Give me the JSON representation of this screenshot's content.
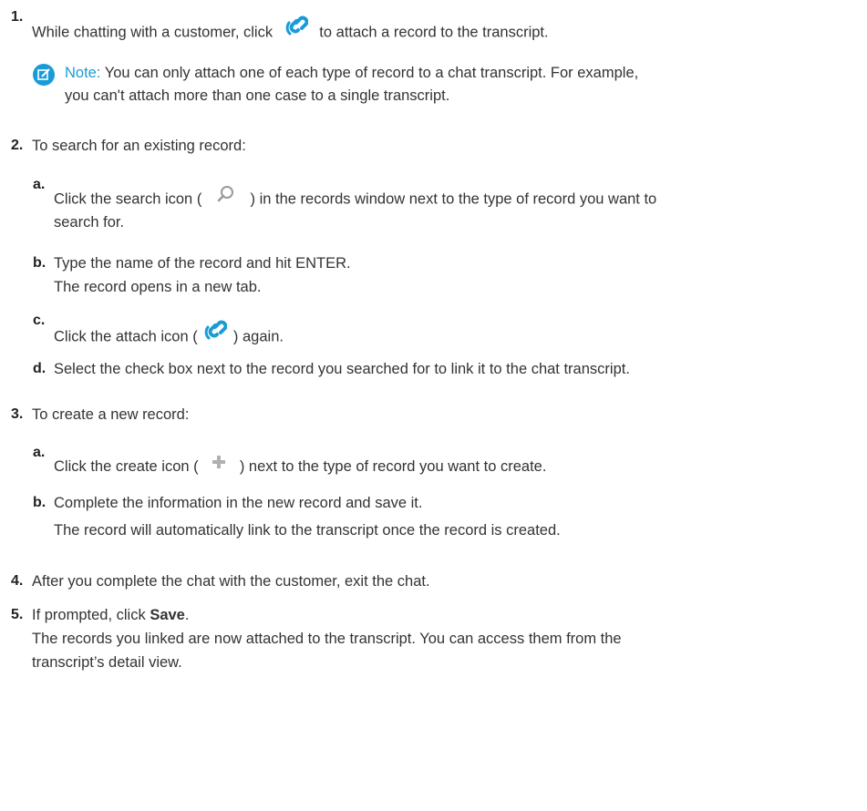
{
  "steps": {
    "s1": {
      "num": "1.",
      "pre": "While chatting with a customer, click",
      "post": "to attach a record to the transcript.",
      "note": {
        "label": "Note:",
        "line1": "You can only attach one of each type of record to a chat transcript. For example,",
        "line2": "you can't attach more than one case to a single transcript."
      }
    },
    "s2": {
      "num": "2.",
      "text": "To search for an existing record:",
      "a": {
        "num": "a.",
        "pre": "Click the search icon (",
        "post": ") in the records window next to the type of record you want to",
        "line2": "search for."
      },
      "b": {
        "num": "b.",
        "line1": "Type the name of the record and hit ENTER.",
        "line2": "The record opens in a new tab."
      },
      "c": {
        "num": "c.",
        "pre": "Click the attach icon (",
        "post": ") again."
      },
      "d": {
        "num": "d.",
        "text": "Select the check box next to the record you searched for to link it to the chat transcript."
      }
    },
    "s3": {
      "num": "3.",
      "text": "To create a new record:",
      "a": {
        "num": "a.",
        "pre": "Click the create icon (",
        "post": ") next to the type of record you want to create."
      },
      "b": {
        "num": "b.",
        "line1": "Complete the information in the new record and save it.",
        "line2": "The record will automatically link to the transcript once the record is created."
      }
    },
    "s4": {
      "num": "4.",
      "text": "After you complete the chat with the customer, exit the chat."
    },
    "s5": {
      "num": "5.",
      "pre": "If prompted, click",
      "bold": "Save",
      "post": ".",
      "line2": "The records you linked are now attached to the transcript. You can access them from the",
      "line3": "transcript’s detail view."
    }
  },
  "colors": {
    "accent": "#1a9bd7",
    "icon_gray": "#9a9a9a"
  }
}
